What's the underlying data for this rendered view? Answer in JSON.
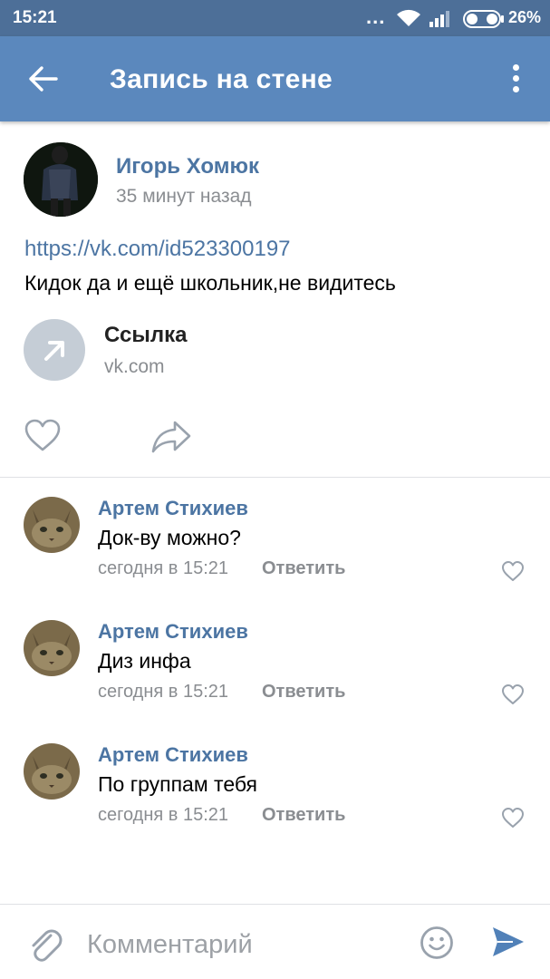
{
  "status_bar": {
    "time": "15:21",
    "dots": "...",
    "battery_percent": "26%",
    "battery_level": 0.26
  },
  "app_bar": {
    "title": "Запись на стене",
    "back_icon": "arrow-left-icon",
    "menu_icon": "more-vertical-icon"
  },
  "post": {
    "author": "Игорь Хомюк",
    "time": "35 минут назад",
    "link": "https://vk.com/id523300197",
    "text": "Кидок да и ещё школьник,не видитесь",
    "attachment": {
      "title": "Ссылка",
      "domain": "vk.com",
      "icon": "arrow-up-right-icon"
    },
    "like_icon": "heart-icon",
    "share_icon": "share-icon"
  },
  "comments": [
    {
      "author": "Артем Стихиев",
      "text": "Док-ву можно?",
      "time": "сегодня в 15:21",
      "reply_label": "Ответить"
    },
    {
      "author": "Артем Стихиев",
      "text": "Диз инфа",
      "time": "сегодня в 15:21",
      "reply_label": "Ответить"
    },
    {
      "author": "Артем Стихиев",
      "text": "По группам тебя",
      "time": "сегодня в 15:21",
      "reply_label": "Ответить"
    }
  ],
  "input_bar": {
    "placeholder": "Комментарий",
    "attach_icon": "paperclip-icon",
    "emoji_icon": "smile-icon",
    "send_icon": "send-icon"
  },
  "colors": {
    "status_bar": "#4d6f98",
    "app_bar": "#5b88bd",
    "link": "#4c75a3",
    "secondary_text": "#8a8d91"
  }
}
